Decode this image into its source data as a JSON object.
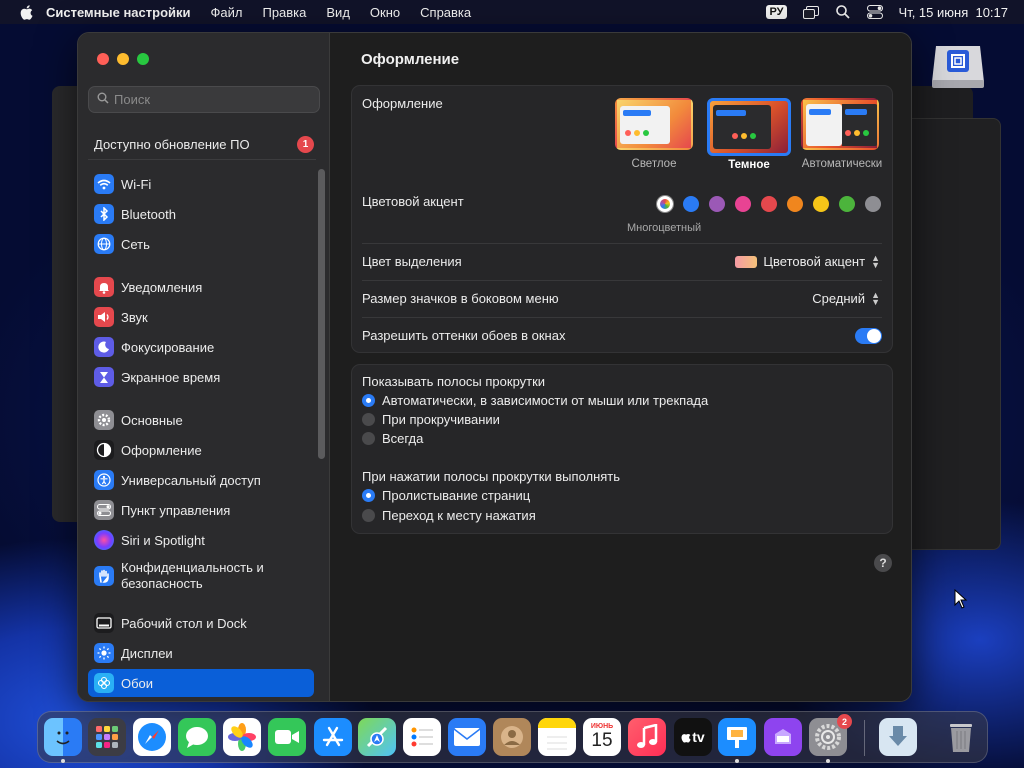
{
  "menubar": {
    "app_name": "Системные настройки",
    "menus": [
      "Файл",
      "Правка",
      "Вид",
      "Окно",
      "Справка"
    ],
    "input_lang": "РУ",
    "datetime": "Чт, 15 июня  10:17"
  },
  "sidebar": {
    "search_placeholder": "Поиск",
    "update_label": "Доступно обновление ПО",
    "update_count": "1",
    "items": [
      {
        "label": "Wi-Fi",
        "icon": "wifi-icon",
        "color": "#2a7bf5"
      },
      {
        "label": "Bluetooth",
        "icon": "bluetooth-icon",
        "color": "#2a7bf5"
      },
      {
        "label": "Сеть",
        "icon": "globe-icon",
        "color": "#2a7bf5"
      },
      {
        "label": "Уведомления",
        "icon": "bell-icon",
        "color": "#e5484d"
      },
      {
        "label": "Звук",
        "icon": "speaker-icon",
        "color": "#e5484d"
      },
      {
        "label": "Фокусирование",
        "icon": "moon-icon",
        "color": "#5e5ce6"
      },
      {
        "label": "Экранное время",
        "icon": "hourglass-icon",
        "color": "#5e5ce6"
      },
      {
        "label": "Основные",
        "icon": "gear-icon",
        "color": "#8e8e93"
      },
      {
        "label": "Оформление",
        "icon": "appearance-icon",
        "color": "#1c1c1e"
      },
      {
        "label": "Универсальный доступ",
        "icon": "accessibility-icon",
        "color": "#2a7bf5"
      },
      {
        "label": "Пункт управления",
        "icon": "control-center-icon",
        "color": "#8e8e93"
      },
      {
        "label": "Siri и Spotlight",
        "icon": "siri-icon",
        "color": "#7a3cff"
      },
      {
        "label": "Конфиденциальность и безопасность",
        "icon": "hand-icon",
        "color": "#2a7bf5"
      },
      {
        "label": "Рабочий стол и Dock",
        "icon": "dock-icon",
        "color": "#1c1c1e"
      },
      {
        "label": "Дисплеи",
        "icon": "sun-icon",
        "color": "#2a7bf5"
      },
      {
        "label": "Обои",
        "icon": "wallpaper-icon",
        "color": "#2ab0f5"
      }
    ]
  },
  "content": {
    "title": "Оформление",
    "appearance_label": "Оформление",
    "themes": [
      {
        "label": "Светлое",
        "selected": false
      },
      {
        "label": "Темное",
        "selected": true
      },
      {
        "label": "Автоматически",
        "selected": false
      }
    ],
    "accent_label": "Цветовой акцент",
    "accent_colors": [
      "#2a7bf5",
      "#9b59b6",
      "#e84393",
      "#e5484d",
      "#f0861e",
      "#f5c518",
      "#4cb43c",
      "#8e8e93"
    ],
    "accent_caption": "Многоцветный",
    "highlight_label": "Цвет выделения",
    "highlight_value": "Цветовой акцент",
    "icon_size_label": "Размер значков в боковом меню",
    "icon_size_value": "Средний",
    "tint_label": "Разрешить оттенки обоев в окнах",
    "tint_enabled": true,
    "scrollbars_label": "Показывать полосы прокрутки",
    "scrollbar_options": [
      {
        "label": "Автоматически, в зависимости от мыши или трекпада",
        "selected": true
      },
      {
        "label": "При прокручивании",
        "selected": false
      },
      {
        "label": "Всегда",
        "selected": false
      }
    ],
    "click_label": "При нажатии полосы прокрутки выполнять",
    "click_options": [
      {
        "label": "Пролистывание страниц",
        "selected": true
      },
      {
        "label": "Переход к месту нажатия",
        "selected": false
      }
    ],
    "help": "?"
  },
  "dock": {
    "apps": [
      "finder-icon",
      "launchpad-icon",
      "safari-icon",
      "messages-icon",
      "photos-icon",
      "facetime-icon",
      "app-store-icon",
      "maps-icon",
      "reminders-icon",
      "mail-icon",
      "contacts-icon",
      "notes-icon",
      "calendar-icon",
      "music-icon",
      "tv-icon",
      "keynote-icon",
      "podcasts-icon",
      "system-settings-icon",
      "downloads-icon",
      "trash-icon"
    ],
    "calendar_month": "ИЮНЬ",
    "calendar_day": "15",
    "tv_label": "tv",
    "settings_badge": "2"
  }
}
